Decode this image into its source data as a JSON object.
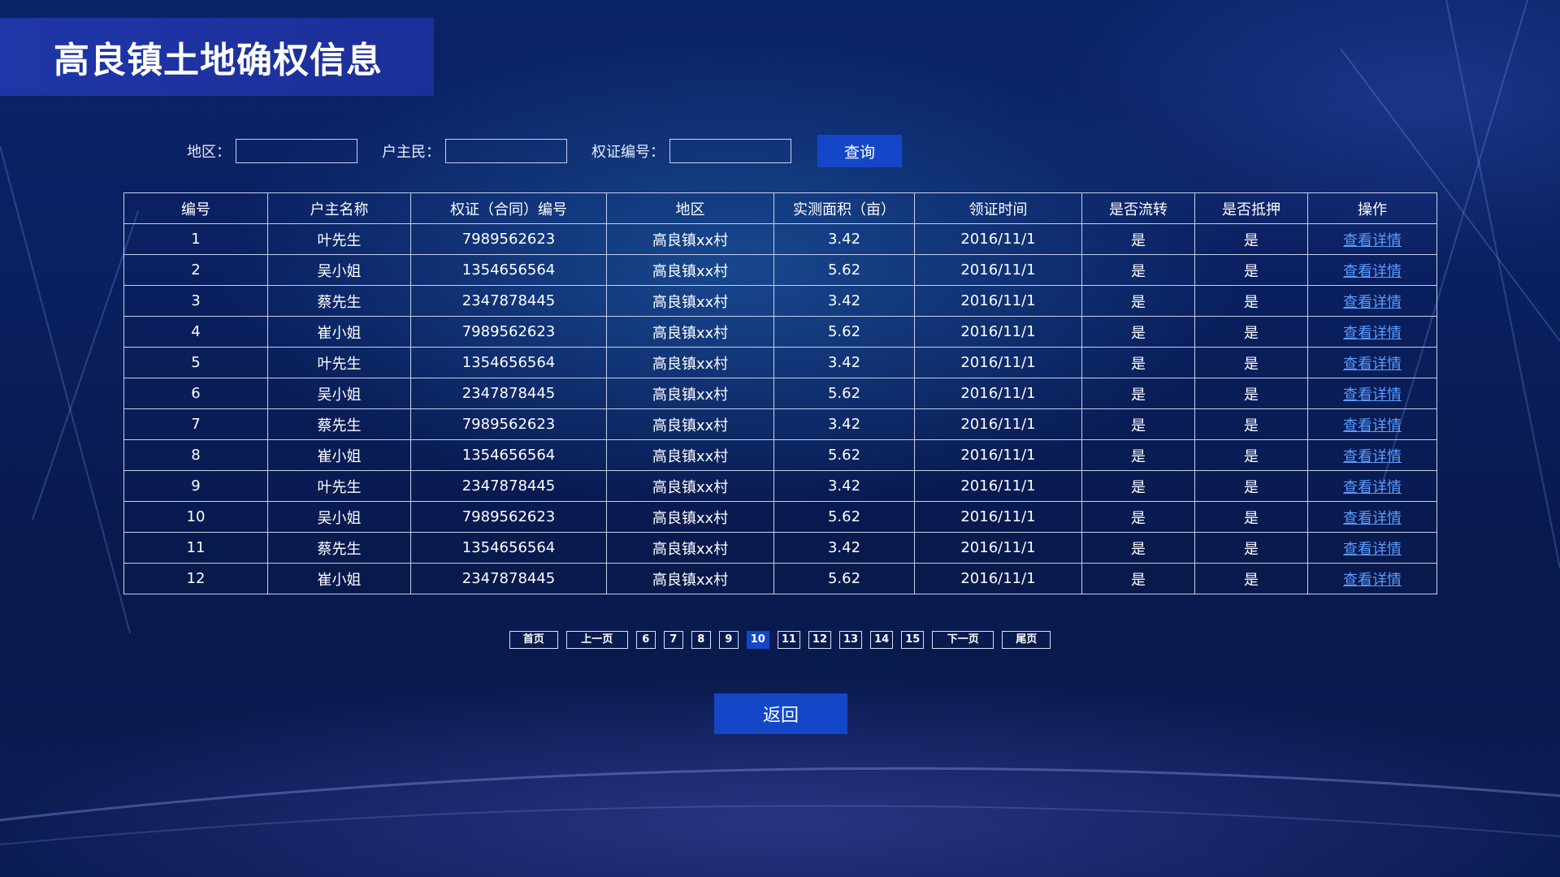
{
  "page": {
    "title": "高良镇土地确权信息"
  },
  "search": {
    "region_label": "地区：",
    "owner_label": "户主民：",
    "cert_label": "权证编号：",
    "region_value": "",
    "owner_value": "",
    "cert_value": "",
    "query_label": "查询"
  },
  "table": {
    "headers": [
      "编号",
      "户主名称",
      "权证（合同）编号",
      "地区",
      "实测面积（亩）",
      "领证时间",
      "是否流转",
      "是否抵押",
      "操作"
    ],
    "rows": [
      [
        "1",
        "叶先生",
        "7989562623",
        "高良镇xx村",
        "3.42",
        "2016/11/1",
        "是",
        "是",
        "查看详情"
      ],
      [
        "2",
        "吴小姐",
        "1354656564",
        "高良镇xx村",
        "5.62",
        "2016/11/1",
        "是",
        "是",
        "查看详情"
      ],
      [
        "3",
        "蔡先生",
        "2347878445",
        "高良镇xx村",
        "3.42",
        "2016/11/1",
        "是",
        "是",
        "查看详情"
      ],
      [
        "4",
        "崔小姐",
        "7989562623",
        "高良镇xx村",
        "5.62",
        "2016/11/1",
        "是",
        "是",
        "查看详情"
      ],
      [
        "5",
        "叶先生",
        "1354656564",
        "高良镇xx村",
        "3.42",
        "2016/11/1",
        "是",
        "是",
        "查看详情"
      ],
      [
        "6",
        "吴小姐",
        "2347878445",
        "高良镇xx村",
        "5.62",
        "2016/11/1",
        "是",
        "是",
        "查看详情"
      ],
      [
        "7",
        "蔡先生",
        "7989562623",
        "高良镇xx村",
        "3.42",
        "2016/11/1",
        "是",
        "是",
        "查看详情"
      ],
      [
        "8",
        "崔小姐",
        "1354656564",
        "高良镇xx村",
        "5.62",
        "2016/11/1",
        "是",
        "是",
        "查看详情"
      ],
      [
        "9",
        "叶先生",
        "2347878445",
        "高良镇xx村",
        "3.42",
        "2016/11/1",
        "是",
        "是",
        "查看详情"
      ],
      [
        "10",
        "吴小姐",
        "7989562623",
        "高良镇xx村",
        "5.62",
        "2016/11/1",
        "是",
        "是",
        "查看详情"
      ],
      [
        "11",
        "蔡先生",
        "1354656564",
        "高良镇xx村",
        "3.42",
        "2016/11/1",
        "是",
        "是",
        "查看详情"
      ],
      [
        "12",
        "崔小姐",
        "2347878445",
        "高良镇xx村",
        "5.62",
        "2016/11/1",
        "是",
        "是",
        "查看详情"
      ]
    ]
  },
  "pager": {
    "first": "首页",
    "prev": "上一页",
    "pages": [
      "6",
      "7",
      "8",
      "9",
      "10",
      "11",
      "12",
      "13",
      "14",
      "15"
    ],
    "current": "10",
    "next": "下一页",
    "last": "尾页"
  },
  "back_label": "返回",
  "colors": {
    "accent": "#1447c8",
    "title_bg": "#1f36a8",
    "link": "#5b9cff"
  }
}
